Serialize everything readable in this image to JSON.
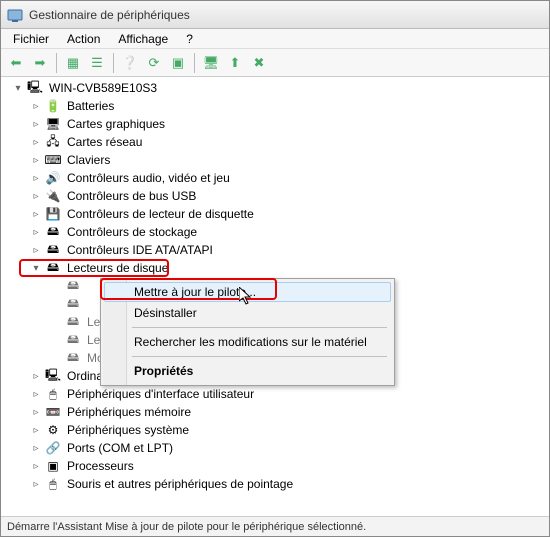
{
  "window": {
    "title": "Gestionnaire de périphériques"
  },
  "menubar": {
    "items": [
      "Fichier",
      "Action",
      "Affichage",
      "?"
    ]
  },
  "toolbar": {
    "buttons": [
      {
        "name": "back",
        "glyph": "⬅"
      },
      {
        "name": "forward",
        "glyph": "➡"
      },
      {
        "name": "sep"
      },
      {
        "name": "show-hidden",
        "glyph": "▦"
      },
      {
        "name": "properties",
        "glyph": "☰"
      },
      {
        "name": "sep"
      },
      {
        "name": "help",
        "glyph": "❔"
      },
      {
        "name": "refresh",
        "glyph": "⟳"
      },
      {
        "name": "stop",
        "glyph": "▣"
      },
      {
        "name": "sep"
      },
      {
        "name": "scan-hardware",
        "glyph": "🖥"
      },
      {
        "name": "update-driver",
        "glyph": "⬆"
      },
      {
        "name": "uninstall",
        "glyph": "✖"
      }
    ]
  },
  "tree": {
    "root": {
      "label": "WIN-CVB589E10S3",
      "expanded": true
    },
    "categories": [
      {
        "label": "Batteries",
        "icon": "battery",
        "expanded": false
      },
      {
        "label": "Cartes graphiques",
        "icon": "display",
        "expanded": false
      },
      {
        "label": "Cartes réseau",
        "icon": "network",
        "expanded": false
      },
      {
        "label": "Claviers",
        "icon": "keyboard",
        "expanded": false
      },
      {
        "label": "Contrôleurs audio, vidéo et jeu",
        "icon": "sound",
        "expanded": false
      },
      {
        "label": "Contrôleurs de bus USB",
        "icon": "usb",
        "expanded": false
      },
      {
        "label": "Contrôleurs de lecteur de disquette",
        "icon": "floppy-ctrl",
        "expanded": false
      },
      {
        "label": "Contrôleurs de stockage",
        "icon": "storage-ctrl",
        "expanded": false
      },
      {
        "label": "Contrôleurs IDE ATA/ATAPI",
        "icon": "ide",
        "expanded": false
      },
      {
        "label": "Lecteurs de disque",
        "icon": "disk",
        "expanded": true,
        "highlighted": true,
        "children": [
          {
            "label": "",
            "icon": "disk",
            "obscured": true
          },
          {
            "label": "",
            "icon": "disk",
            "obscured": true
          },
          {
            "label": "Lect",
            "icon": "disk",
            "obscured": true
          },
          {
            "label": "Lect",
            "icon": "disk",
            "obscured": true
          },
          {
            "label": "Mo",
            "icon": "disk",
            "obscured": true
          }
        ]
      },
      {
        "label": "Ordinateur",
        "icon": "computer",
        "expanded": false
      },
      {
        "label": "Périphériques d'interface utilisateur",
        "icon": "hid",
        "expanded": false
      },
      {
        "label": "Périphériques mémoire",
        "icon": "memory",
        "expanded": false
      },
      {
        "label": "Périphériques système",
        "icon": "system",
        "expanded": false
      },
      {
        "label": "Ports (COM et LPT)",
        "icon": "port",
        "expanded": false
      },
      {
        "label": "Processeurs",
        "icon": "cpu",
        "expanded": false
      },
      {
        "label": "Souris et autres périphériques de pointage",
        "icon": "mouse",
        "expanded": false
      }
    ]
  },
  "context_menu": {
    "items": [
      {
        "label": "Mettre à jour le pilote...",
        "hovered": true,
        "highlighted": true
      },
      {
        "label": "Désinstaller"
      },
      {
        "sep": true
      },
      {
        "label": "Rechercher les modifications sur le matériel"
      },
      {
        "sep": true
      },
      {
        "label": "Propriétés",
        "bold": true
      }
    ]
  },
  "statusbar": {
    "text": "Démarre l'Assistant Mise à jour de pilote pour le périphérique sélectionné."
  },
  "icons": {
    "battery": "🔋",
    "display": "🖥",
    "network": "🖧",
    "keyboard": "⌨",
    "sound": "🔊",
    "usb": "🔌",
    "floppy-ctrl": "💾",
    "storage-ctrl": "🖴",
    "ide": "🖴",
    "disk": "🖴",
    "computer": "🖳",
    "hid": "🖱",
    "memory": "📼",
    "system": "⚙",
    "port": "🔗",
    "cpu": "▣",
    "mouse": "🖱",
    "root": "🖳"
  }
}
